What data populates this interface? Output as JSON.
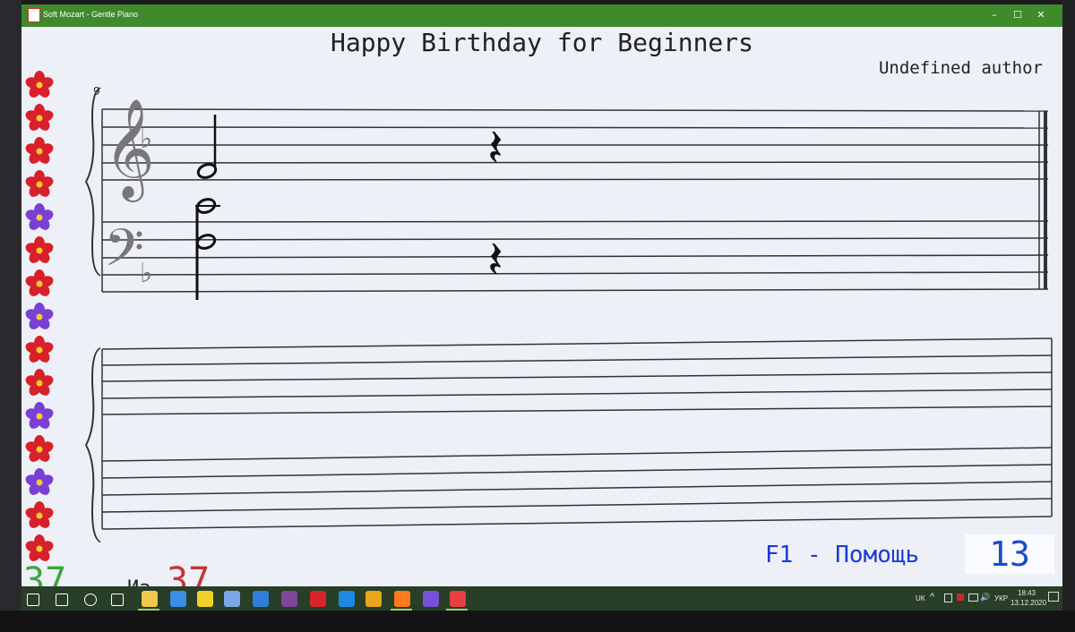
{
  "window": {
    "title": "Soft Mozart - Gentle Piano",
    "minimize": "–",
    "maximize": "☐",
    "close": "✕"
  },
  "score": {
    "title": "Happy Birthday for Beginners",
    "author": "Undefined author",
    "measure_number": "9",
    "notes": [
      "D4 half note (treble)",
      "C4 half note",
      "A3 half note (bass)",
      "quarter rest (treble)",
      "quarter rest (bass)"
    ],
    "key_signature": "one flat"
  },
  "flowers": [
    "red",
    "red",
    "red",
    "red",
    "purple",
    "red",
    "red",
    "purple",
    "red",
    "red",
    "purple",
    "red",
    "purple",
    "red",
    "red"
  ],
  "flower_colors": {
    "red": "#d8202a",
    "purple": "#7a3fd6",
    "center": "#f2d028"
  },
  "status": {
    "current": "37",
    "of_label": "Из",
    "total": "37",
    "help": "F1 - Помощь",
    "page": "13"
  },
  "taskbar": {
    "icons": [
      "windows-start-icon",
      "search-icon",
      "cortana-icon",
      "task-view-icon",
      "file-explorer-icon",
      "calculator-icon",
      "lightning-app-icon",
      "save-app-icon",
      "edge-legacy-icon",
      "tor-icon",
      "opera-icon",
      "edge-icon",
      "chrome-icon",
      "firefox-icon",
      "viber-icon",
      "soft-mozart-icon"
    ],
    "language": "UK",
    "lang2": "УКР",
    "time": "18:43",
    "date": "13.12.2020"
  }
}
